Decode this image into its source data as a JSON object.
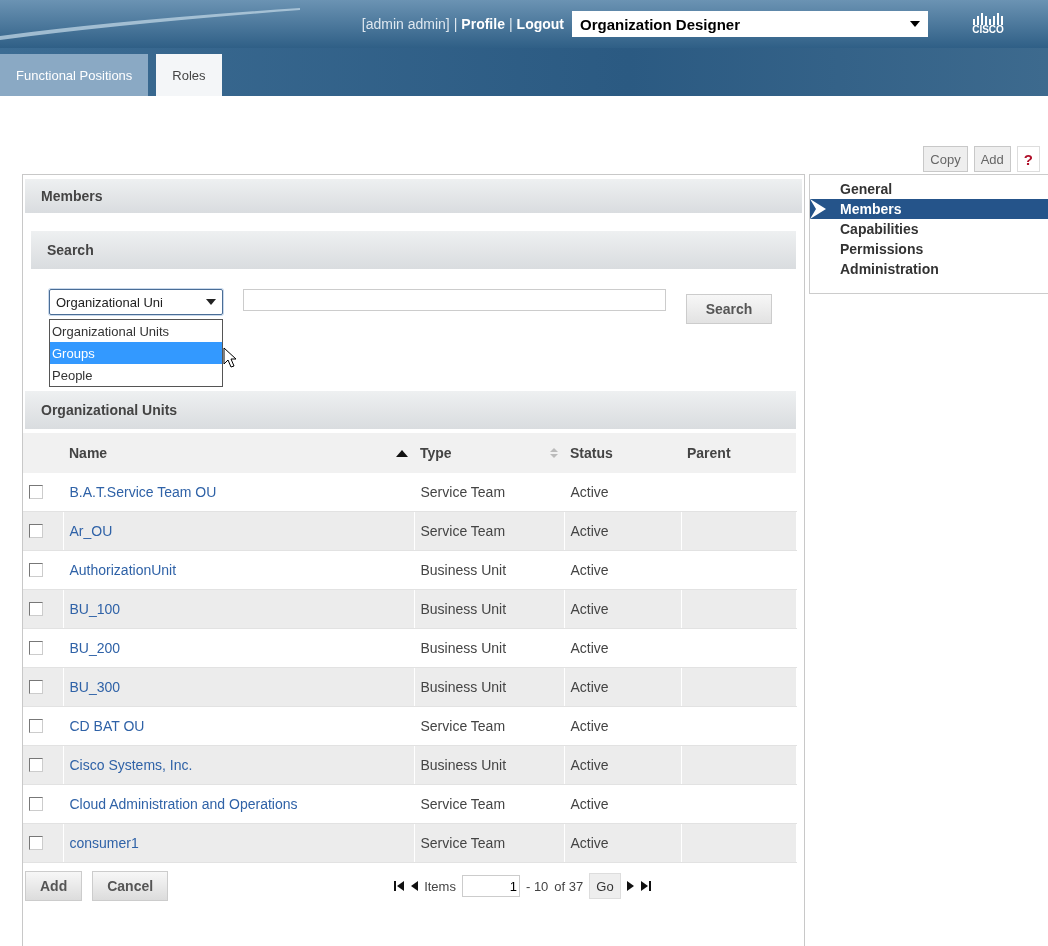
{
  "header": {
    "user_links": [
      {
        "kind": "user",
        "label": "[admin admin]"
      },
      {
        "kind": "separator",
        "label": "|"
      },
      {
        "kind": "link",
        "label": "Profile"
      },
      {
        "kind": "separator",
        "label": "|"
      },
      {
        "kind": "link",
        "label": "Logout"
      }
    ],
    "app_select": {
      "value": "Organization Designer"
    },
    "logo": "CISCO"
  },
  "tabs": [
    {
      "label": "Functional Positions",
      "selected": false
    },
    {
      "label": "Roles",
      "selected": true
    }
  ],
  "actions": [
    {
      "kind": "button",
      "label": "Copy"
    },
    {
      "kind": "button",
      "label": "Add"
    },
    {
      "kind": "help",
      "label": "?"
    }
  ],
  "panel": {
    "title": "Members",
    "search": {
      "title": "Search",
      "type_select": {
        "value": "Organizational Uni",
        "expanded": true,
        "options": [
          {
            "label": "Organizational Units",
            "selected": false
          },
          {
            "label": "Groups",
            "selected": true
          },
          {
            "label": "People",
            "selected": false
          }
        ]
      },
      "button": "Search"
    },
    "results": {
      "title": "Organizational Units",
      "columns": [
        {
          "label": "Name",
          "sorted_ascending": true,
          "sortable": false
        },
        {
          "label": "Type",
          "sorted_ascending": false,
          "sortable": true
        },
        {
          "label": "Status",
          "sorted_ascending": false,
          "sortable": false
        },
        {
          "label": "Parent",
          "sorted_ascending": false,
          "sortable": false
        }
      ],
      "rows": [
        {
          "name": "B.A.T.Service Team OU",
          "type": "Service Team",
          "status": "Active",
          "checked": false
        },
        {
          "name": "Ar_OU",
          "type": "Service Team",
          "status": "Active",
          "checked": false
        },
        {
          "name": "AuthorizationUnit",
          "type": "Business Unit",
          "status": "Active",
          "checked": false
        },
        {
          "name": "BU_100",
          "type": "Business Unit",
          "status": "Active",
          "checked": false
        },
        {
          "name": "BU_200",
          "type": "Business Unit",
          "status": "Active",
          "checked": false
        },
        {
          "name": "BU_300",
          "type": "Business Unit",
          "status": "Active",
          "checked": false
        },
        {
          "name": "CD BAT OU",
          "type": "Service Team",
          "status": "Active",
          "checked": false
        },
        {
          "name": "Cisco Systems, Inc.",
          "type": "Business Unit",
          "status": "Active",
          "checked": false
        },
        {
          "name": "Cloud Administration and Operations",
          "type": "Service Team",
          "status": "Active",
          "checked": false
        },
        {
          "name": "consumer1",
          "type": "Service Team",
          "status": "Active",
          "checked": false
        }
      ]
    },
    "footer": {
      "buttons": [
        "Add",
        "Cancel"
      ],
      "pager": {
        "items_label": "Items",
        "page_value": "1",
        "range": "- 10",
        "total": "of 37",
        "go": "Go"
      }
    }
  },
  "side_nav": [
    {
      "label": "General",
      "selected": false
    },
    {
      "label": "Members",
      "selected": true
    },
    {
      "label": "Capabilities",
      "selected": false
    },
    {
      "label": "Permissions",
      "selected": false
    },
    {
      "label": "Administration",
      "selected": false
    }
  ]
}
